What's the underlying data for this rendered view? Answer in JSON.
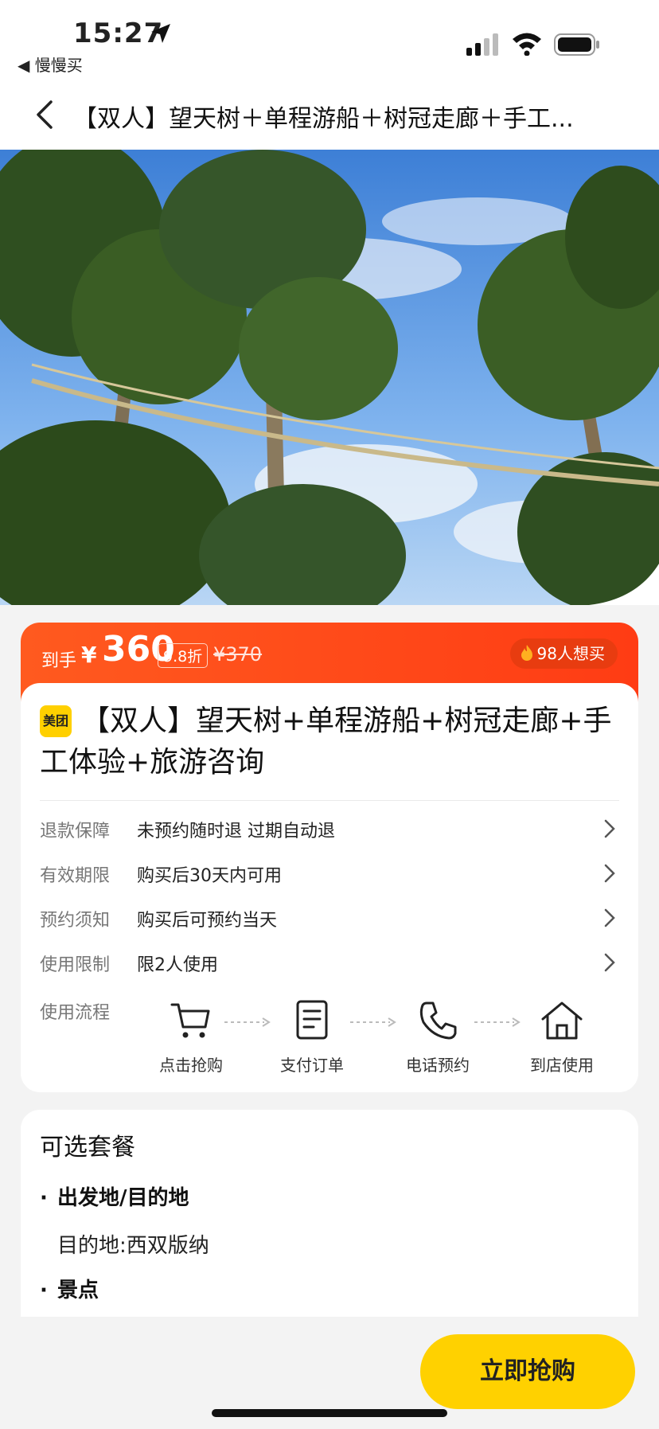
{
  "status_bar": {
    "time": "15:27",
    "back_app": "◀ 慢慢买"
  },
  "nav": {
    "title": "【双人】望天树＋单程游船＋树冠走廊＋手工..."
  },
  "price_bar": {
    "label": "到手",
    "yen": "¥",
    "price": "360",
    "discount": "9.8折",
    "original_price": "¥370",
    "hot_text": "98人想买"
  },
  "product": {
    "badge": "美团",
    "title": "【双人】望天树+单程游船+树冠走廊+手工体验+旅游咨询"
  },
  "info_rows": [
    {
      "key": "退款保障",
      "value": "未预约随时退 过期自动退"
    },
    {
      "key": "有效期限",
      "value": "购买后30天内可用"
    },
    {
      "key": "预约须知",
      "value": "购买后可预约当天"
    },
    {
      "key": "使用限制",
      "value": "限2人使用"
    }
  ],
  "flow": {
    "label": "使用流程",
    "steps": [
      {
        "label": "点击抢购",
        "icon": "cart-icon"
      },
      {
        "label": "支付订单",
        "icon": "document-icon"
      },
      {
        "label": "电话预约",
        "icon": "phone-icon"
      },
      {
        "label": "到店使用",
        "icon": "home-icon"
      }
    ]
  },
  "package": {
    "title": "可选套餐",
    "sections": [
      {
        "heading": "出发地/目的地",
        "value": "目的地:西双版纳"
      },
      {
        "heading": "景点",
        "value": ""
      }
    ]
  },
  "buy_button": {
    "label": "立即抢购"
  },
  "colors": {
    "accent": "#ff4a1a",
    "button": "#ffd100",
    "badge": "#ffd000"
  }
}
